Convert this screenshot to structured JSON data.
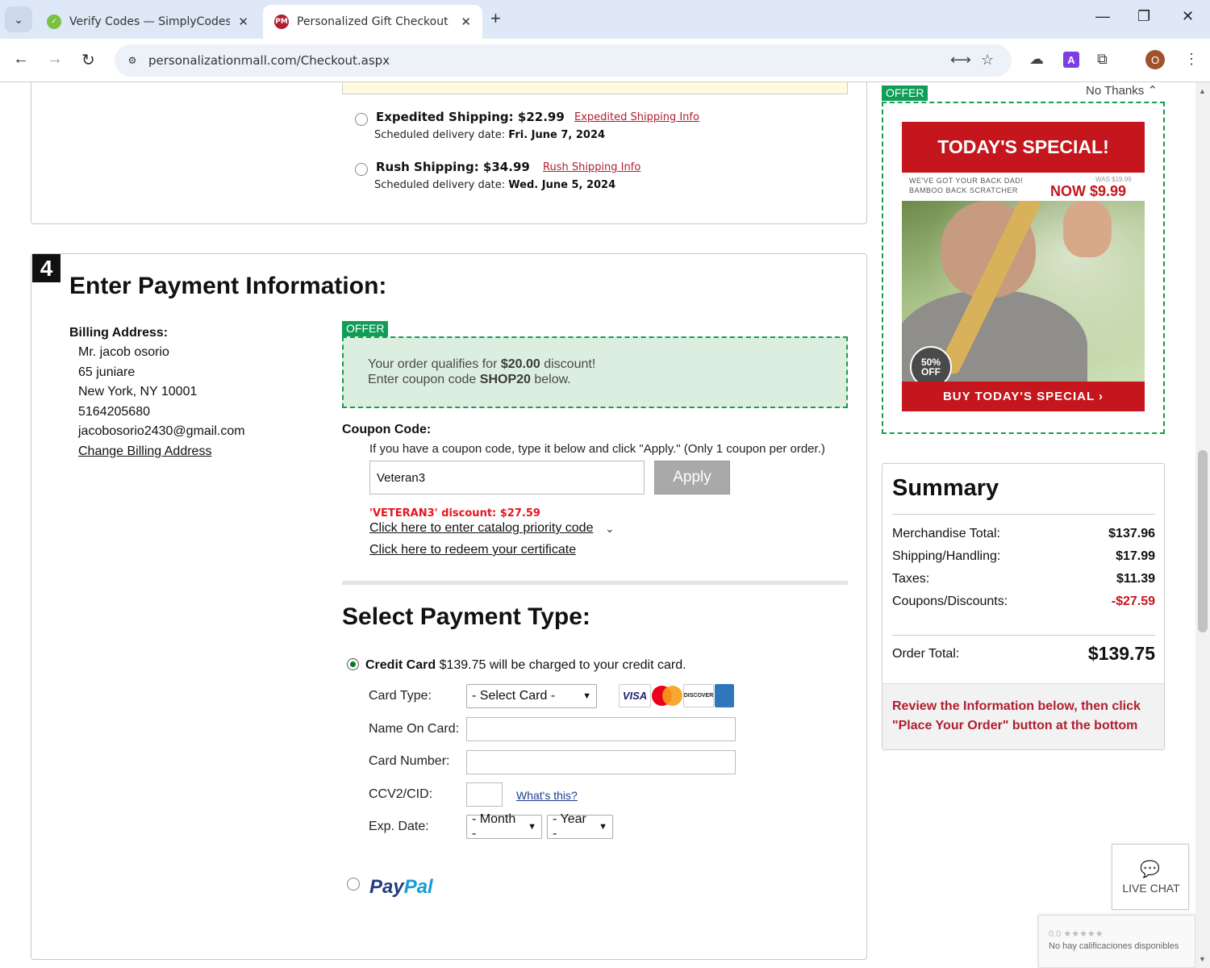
{
  "browser": {
    "tabs": [
      {
        "title": "Verify Codes — SimplyCodes",
        "active": false
      },
      {
        "title": "Personalized Gift Checkout | Pe",
        "active": true
      }
    ],
    "favicon_pm": "PM",
    "url": "personalizationmall.com/Checkout.aspx",
    "profile_initial": "O",
    "ext_letter": "A"
  },
  "shipping": {
    "options": [
      {
        "label": "Expedited Shipping: $22.99",
        "info_link": "Expedited Shipping Info",
        "date_prefix": "Scheduled delivery date:",
        "date": "Fri. June 7, 2024"
      },
      {
        "label": "Rush Shipping: $34.99",
        "info_link": "Rush Shipping Info",
        "date_prefix": "Scheduled delivery date:",
        "date": "Wed. June 5, 2024"
      }
    ]
  },
  "payment": {
    "step_number": "4",
    "title": "Enter Payment Information:",
    "billing": {
      "title": "Billing Address:",
      "lines": [
        "Mr. jacob osorio",
        "65 juniare",
        "New York, NY 10001",
        "5164205680",
        "jacobosorio2430@gmail.com"
      ],
      "change_link": "Change Billing Address"
    },
    "offer": {
      "tag": "OFFER",
      "line1_pre": "Your order qualifies for ",
      "line1_amount": "$20.00",
      "line1_post": " discount!",
      "line2_pre": "Enter coupon code ",
      "line2_code": "SHOP20",
      "line2_post": " below."
    },
    "coupon": {
      "title": "Coupon Code:",
      "help": "If you have a coupon code, type it below and click \"Apply.\" (Only 1 coupon per order.)",
      "value": "Veteran3",
      "apply_label": "Apply",
      "discount_msg": "'VETERAN3' discount: $27.59",
      "catalog_link": "Click here to enter catalog priority code",
      "certificate_link": "Click here to redeem your certificate"
    },
    "type": {
      "title": "Select Payment Type:",
      "credit_card_label": "Credit Card",
      "credit_card_text": "$139.75 will be charged to your credit card.",
      "card_type_label": "Card Type:",
      "card_type_value": "- Select Card -",
      "name_label": "Name On Card:",
      "number_label": "Card Number:",
      "cvv_label": "CCV2/CID:",
      "whats_this": "What's this?",
      "exp_label": "Exp. Date:",
      "month_value": "- Month -",
      "year_value": "- Year -",
      "card_logos": {
        "visa": "VISA",
        "discover": "DISCOVER",
        "amex": "AMERICAN EXPRESS",
        "mastercard": "MasterCard"
      },
      "paypal_1": "Pay",
      "paypal_2": "Pal"
    }
  },
  "special": {
    "tag": "OFFER",
    "no_thanks": "No Thanks",
    "headline": "TODAY'S SPECIAL!",
    "sub1": "WE'VE GOT YOUR BACK DAD!",
    "sub2": "BAMBOO BACK SCRATCHER",
    "was": "WAS $19.99",
    "now": "NOW $9.99",
    "badge_1": "50%",
    "badge_2": "OFF",
    "cta": "BUY TODAY'S SPECIAL ›"
  },
  "summary": {
    "title": "Summary",
    "rows": [
      {
        "label": "Merchandise Total:",
        "value": "$137.96"
      },
      {
        "label": "Shipping/Handling:",
        "value": "$17.99"
      },
      {
        "label": "Taxes:",
        "value": "$11.39"
      },
      {
        "label": "Coupons/Discounts:",
        "value": "-$27.59"
      }
    ],
    "total_label": "Order Total:",
    "total_value": "$139.75",
    "review_line1": "Review the Information below, then click",
    "review_line2": "\"Place Your Order\" button at the bottom"
  },
  "livechat": {
    "label": "LIVE CHAT"
  },
  "recaptcha": {
    "stars": "0.0 ★★★★★",
    "text": "No hay calificaciones disponibles"
  },
  "colors": {
    "accent_red": "#c4161c",
    "offer_green": "#0f9d58",
    "link_red": "#b01e2f"
  }
}
